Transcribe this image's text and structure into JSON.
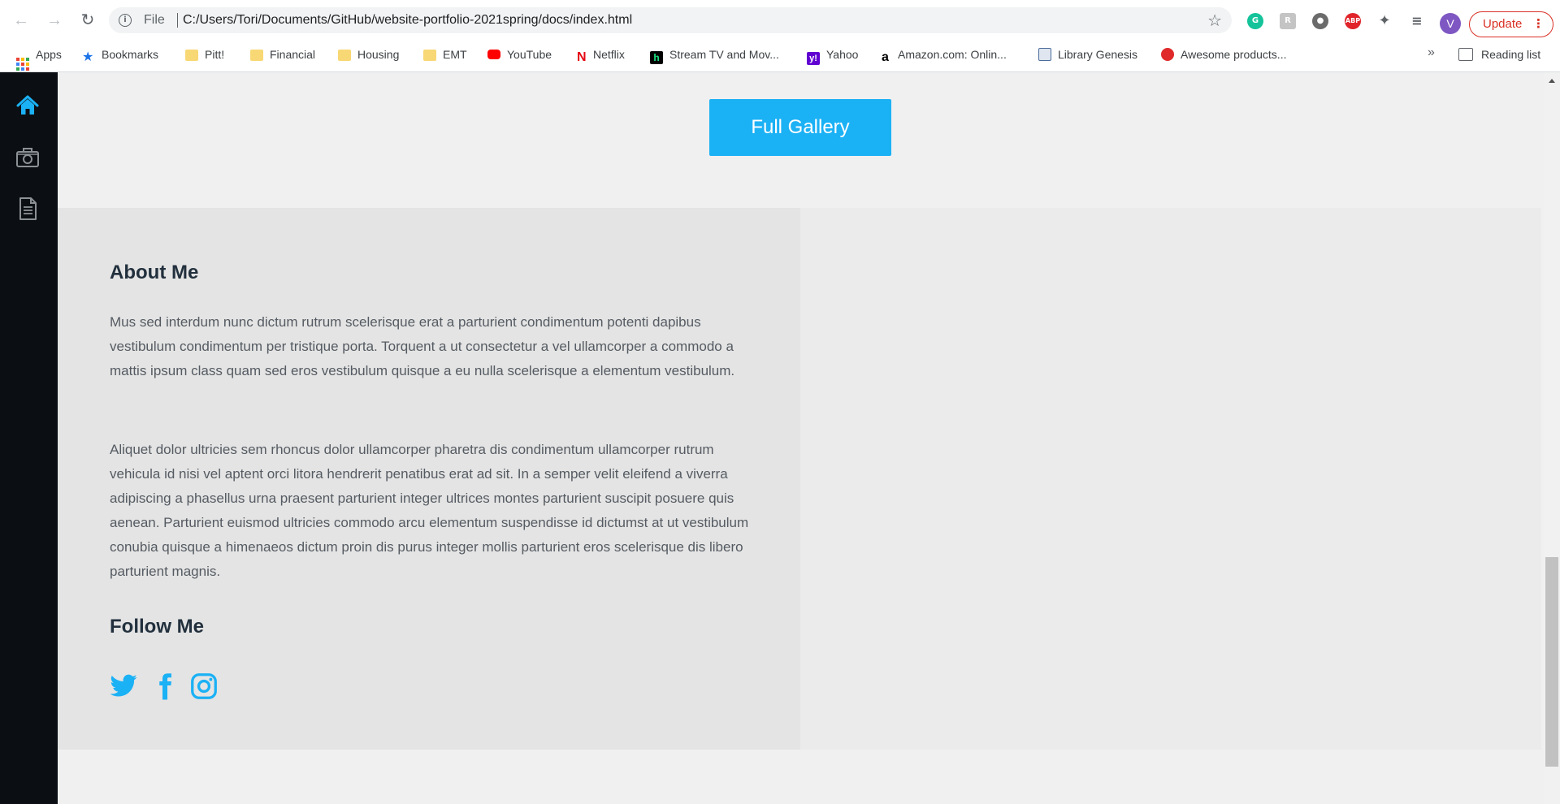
{
  "browser": {
    "omnibox": {
      "scheme_label": "File",
      "url": "C:/Users/Tori/Documents/GitHub/website-portfolio-2021spring/docs/index.html"
    },
    "profile_initial": "V",
    "update_label": "Update",
    "bookmarks": [
      {
        "label": "Apps",
        "icon": "apps-grid-icon"
      },
      {
        "label": "Bookmarks",
        "icon": "star-icon"
      },
      {
        "label": "Pitt!",
        "icon": "folder-icon"
      },
      {
        "label": "Financial",
        "icon": "folder-icon"
      },
      {
        "label": "Housing",
        "icon": "folder-icon"
      },
      {
        "label": "EMT",
        "icon": "folder-icon"
      },
      {
        "label": "YouTube",
        "icon": "youtube-icon"
      },
      {
        "label": "Netflix",
        "icon": "netflix-icon"
      },
      {
        "label": "Stream TV and Mov...",
        "icon": "hulu-icon"
      },
      {
        "label": "Yahoo",
        "icon": "yahoo-icon"
      },
      {
        "label": "Amazon.com: Onlin...",
        "icon": "amazon-icon"
      },
      {
        "label": "Library Genesis",
        "icon": "library-icon"
      },
      {
        "label": "Awesome products...",
        "icon": "awesome-icon"
      }
    ],
    "more_label": "»",
    "reading_list_label": "Reading list"
  },
  "page": {
    "gallery_button": "Full Gallery",
    "about": {
      "title": "About Me",
      "paragraphs": [
        "Mus sed interdum nunc dictum rutrum scelerisque erat a parturient condimentum potenti dapibus vestibulum condimentum per tristique porta. Torquent a ut consectetur a vel ullamcorper a commodo a mattis ipsum class quam sed eros vestibulum quisque a eu nulla scelerisque a elementum vestibulum.",
        "Aliquet dolor ultricies sem rhoncus dolor ullamcorper pharetra dis condimentum ullamcorper rutrum vehicula id nisi vel aptent orci litora hendrerit penatibus erat ad sit. In a semper velit eleifend a viverra adipiscing a phasellus urna praesent parturient integer ultrices montes parturient suscipit posuere quis aenean. Parturient euismod ultricies commodo arcu elementum suspendisse id dictumst at ut vestibulum conubia quisque a himenaeos dictum proin dis purus integer mollis parturient eros scelerisque dis libero parturient magnis."
      ]
    },
    "follow": {
      "title": "Follow Me",
      "links": [
        "twitter-icon",
        "facebook-icon",
        "instagram-icon"
      ]
    }
  },
  "colors": {
    "accent": "#1bb1f5",
    "sidebar_bg": "#0b0f13",
    "about_panel_bg": "#e4e4e4",
    "right_panel_bg": "#ebebeb"
  }
}
